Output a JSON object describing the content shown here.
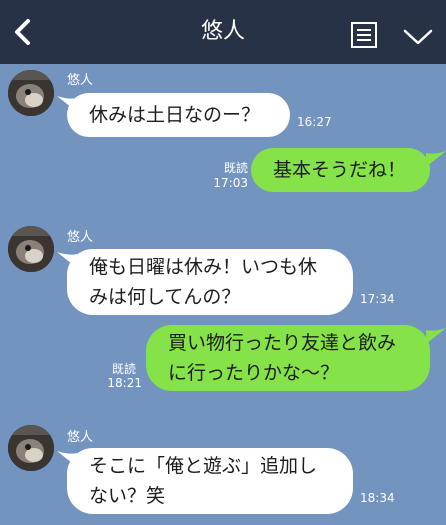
{
  "header": {
    "title": "悠人",
    "back_icon": "chevron-left-icon",
    "menu_icon": "note-list-icon",
    "dropdown_icon": "chevron-down-icon",
    "bg_color": "#273246"
  },
  "chat": {
    "bg_color": "#7494c0",
    "incoming_color": "#ffffff",
    "outgoing_color": "#85e249",
    "messages": [
      {
        "direction": "in",
        "sender": "悠人",
        "text": "休みは土日なのー？",
        "time": "16:27"
      },
      {
        "direction": "out",
        "read": "既読",
        "text": "基本そうだね！",
        "time": "17:03"
      },
      {
        "direction": "in",
        "sender": "悠人",
        "text": "俺も日曜は休み！いつも休\nみは何してんの？",
        "time": "17:34"
      },
      {
        "direction": "out",
        "read": "既読",
        "text": "買い物行ったり友達と飲み\nに行ったりかな～？",
        "time": "18:21"
      },
      {
        "direction": "in",
        "sender": "悠人",
        "text": "そこに「俺と遊ぶ」追加し\nない？笑",
        "time": "18:34"
      }
    ]
  }
}
